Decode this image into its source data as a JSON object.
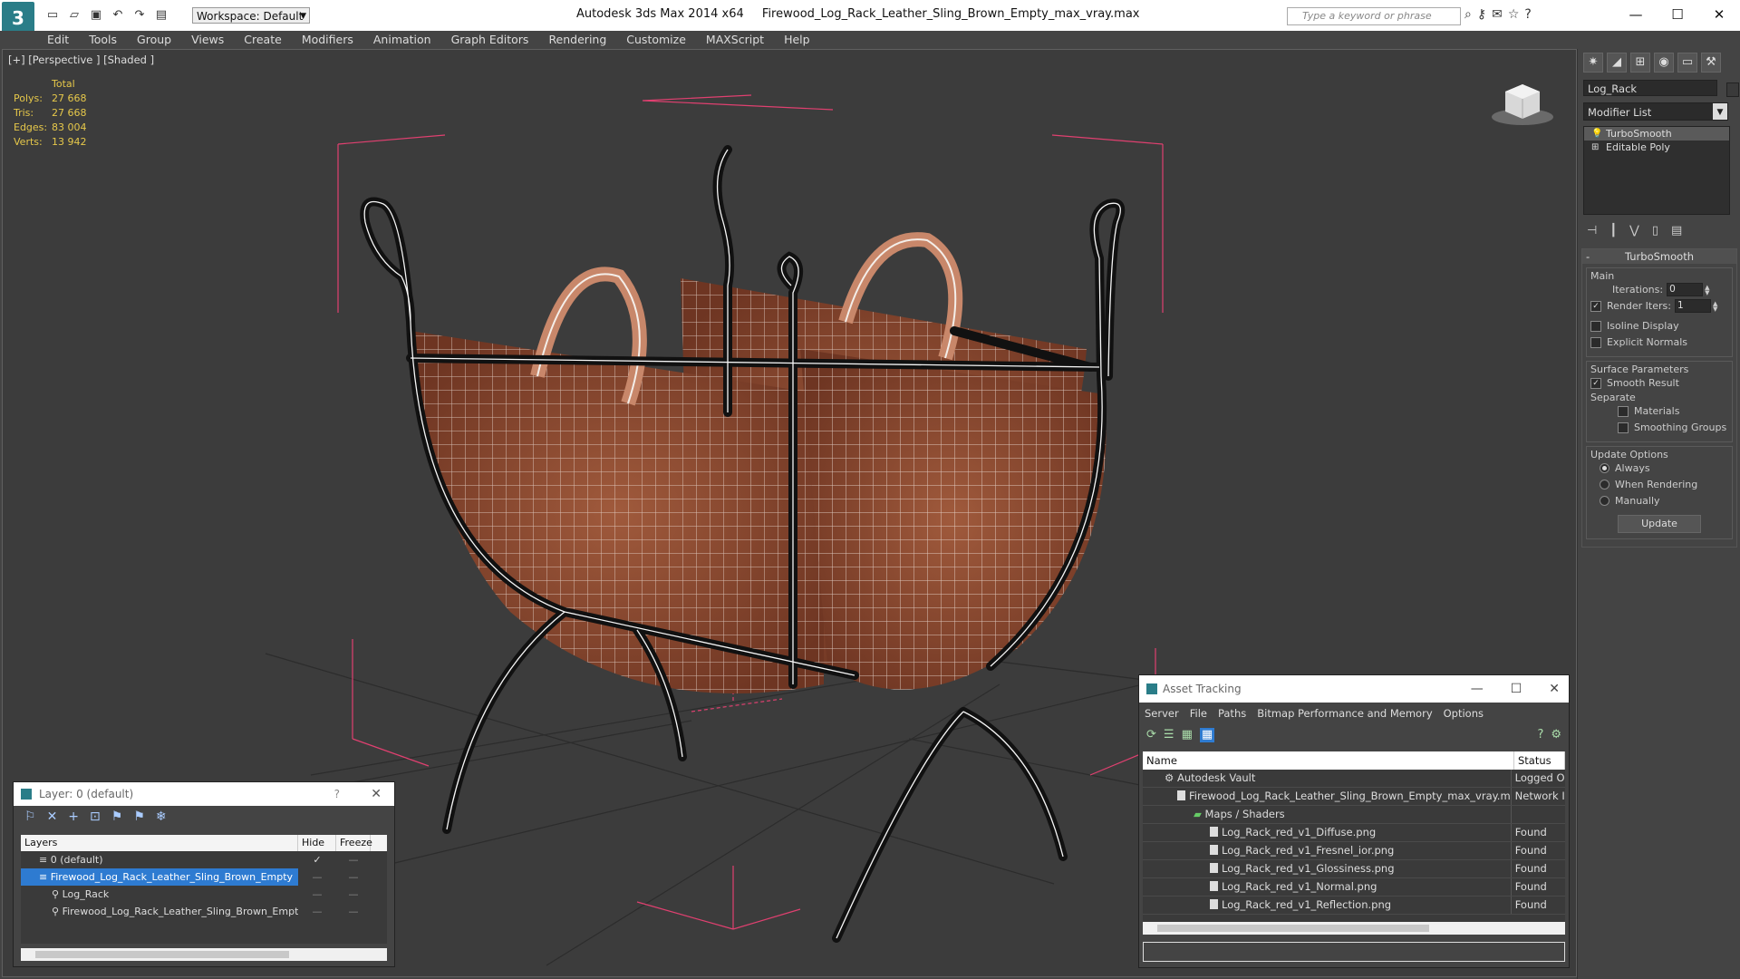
{
  "app": {
    "name": "Autodesk 3ds Max  2014 x64",
    "file": "Firewood_Log_Rack_Leather_Sling_Brown_Empty_max_vray.max",
    "workspace": "Workspace: Default",
    "search_placeholder": "Type a keyword or phrase"
  },
  "menu": [
    "Edit",
    "Tools",
    "Group",
    "Views",
    "Create",
    "Modifiers",
    "Animation",
    "Graph Editors",
    "Rendering",
    "Customize",
    "MAXScript",
    "Help"
  ],
  "viewport": {
    "label": "[+] [Perspective ] [Shaded ]",
    "stats": {
      "total_label": "Total",
      "rows": [
        {
          "label": "Polys:",
          "value": "27 668"
        },
        {
          "label": "Tris:",
          "value": "27 668"
        },
        {
          "label": "Edges:",
          "value": "83 004"
        },
        {
          "label": "Verts:",
          "value": "13 942"
        }
      ]
    }
  },
  "command_panel": {
    "object_name": "Log_Rack",
    "modifier_list": "Modifier List",
    "stack": [
      "TurboSmooth",
      "Editable Poly"
    ],
    "rollout": {
      "title": "TurboSmooth",
      "main_label": "Main",
      "iterations_label": "Iterations:",
      "iterations_value": "0",
      "render_iters_label": "Render Iters:",
      "render_iters_value": "1",
      "isoline": "Isoline Display",
      "explicit_normals": "Explicit Normals",
      "surface_label": "Surface Parameters",
      "smooth_result": "Smooth Result",
      "separate_label": "Separate",
      "materials": "Materials",
      "smoothing_groups": "Smoothing Groups",
      "update_options_label": "Update Options",
      "always": "Always",
      "when_rendering": "When Rendering",
      "manually": "Manually",
      "update_button": "Update"
    }
  },
  "layer_window": {
    "title": "Layer: 0 (default)",
    "help": "?",
    "columns": [
      "Layers",
      "Hide",
      "Freeze"
    ],
    "rows": [
      {
        "name": "0 (default)",
        "indent": 1,
        "selected": false
      },
      {
        "name": "Firewood_Log_Rack_Leather_Sling_Brown_Empty",
        "indent": 1,
        "selected": true
      },
      {
        "name": "Log_Rack",
        "indent": 2,
        "selected": false
      },
      {
        "name": "Firewood_Log_Rack_Leather_Sling_Brown_Empty",
        "indent": 2,
        "selected": false
      }
    ]
  },
  "asset_tracking": {
    "title": "Asset Tracking",
    "menu": [
      "Server",
      "File",
      "Paths",
      "Bitmap Performance and Memory",
      "Options"
    ],
    "columns": [
      "Name",
      "Status"
    ],
    "rows": [
      {
        "name": "Autodesk Vault",
        "status": "Logged O",
        "indent": 1
      },
      {
        "name": "Firewood_Log_Rack_Leather_Sling_Brown_Empty_max_vray.max",
        "status": "Network I",
        "indent": 2
      },
      {
        "name": "Maps / Shaders",
        "status": "",
        "indent": 3
      },
      {
        "name": "Log_Rack_red_v1_Diffuse.png",
        "status": "Found",
        "indent": 4
      },
      {
        "name": "Log_Rack_red_v1_Fresnel_ior.png",
        "status": "Found",
        "indent": 4
      },
      {
        "name": "Log_Rack_red_v1_Glossiness.png",
        "status": "Found",
        "indent": 4
      },
      {
        "name": "Log_Rack_red_v1_Normal.png",
        "status": "Found",
        "indent": 4
      },
      {
        "name": "Log_Rack_red_v1_Reflection.png",
        "status": "Found",
        "indent": 4
      }
    ]
  },
  "colors": {
    "accent": "#2e7bd1",
    "stats": "#e6c84a",
    "wire": "#ffffff",
    "leather": "#8a4a32"
  }
}
